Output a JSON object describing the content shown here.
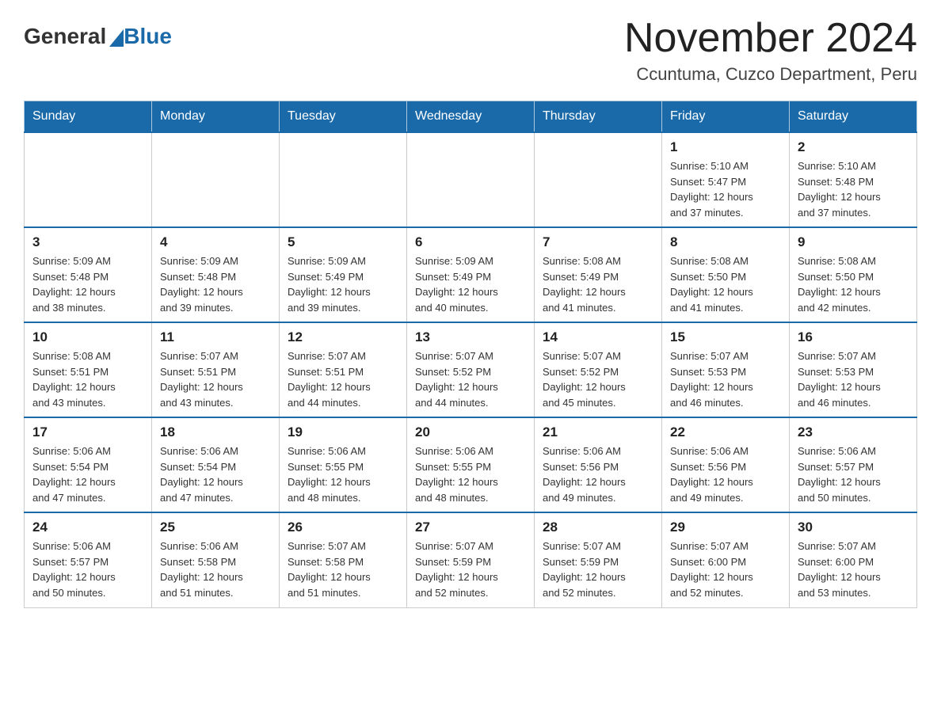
{
  "header": {
    "logo_general": "General",
    "logo_blue": "Blue",
    "title": "November 2024",
    "subtitle": "Ccuntuma, Cuzco Department, Peru"
  },
  "days_of_week": [
    "Sunday",
    "Monday",
    "Tuesday",
    "Wednesday",
    "Thursday",
    "Friday",
    "Saturday"
  ],
  "weeks": [
    {
      "days": [
        {
          "number": "",
          "info": ""
        },
        {
          "number": "",
          "info": ""
        },
        {
          "number": "",
          "info": ""
        },
        {
          "number": "",
          "info": ""
        },
        {
          "number": "",
          "info": ""
        },
        {
          "number": "1",
          "info": "Sunrise: 5:10 AM\nSunset: 5:47 PM\nDaylight: 12 hours\nand 37 minutes."
        },
        {
          "number": "2",
          "info": "Sunrise: 5:10 AM\nSunset: 5:48 PM\nDaylight: 12 hours\nand 37 minutes."
        }
      ]
    },
    {
      "days": [
        {
          "number": "3",
          "info": "Sunrise: 5:09 AM\nSunset: 5:48 PM\nDaylight: 12 hours\nand 38 minutes."
        },
        {
          "number": "4",
          "info": "Sunrise: 5:09 AM\nSunset: 5:48 PM\nDaylight: 12 hours\nand 39 minutes."
        },
        {
          "number": "5",
          "info": "Sunrise: 5:09 AM\nSunset: 5:49 PM\nDaylight: 12 hours\nand 39 minutes."
        },
        {
          "number": "6",
          "info": "Sunrise: 5:09 AM\nSunset: 5:49 PM\nDaylight: 12 hours\nand 40 minutes."
        },
        {
          "number": "7",
          "info": "Sunrise: 5:08 AM\nSunset: 5:49 PM\nDaylight: 12 hours\nand 41 minutes."
        },
        {
          "number": "8",
          "info": "Sunrise: 5:08 AM\nSunset: 5:50 PM\nDaylight: 12 hours\nand 41 minutes."
        },
        {
          "number": "9",
          "info": "Sunrise: 5:08 AM\nSunset: 5:50 PM\nDaylight: 12 hours\nand 42 minutes."
        }
      ]
    },
    {
      "days": [
        {
          "number": "10",
          "info": "Sunrise: 5:08 AM\nSunset: 5:51 PM\nDaylight: 12 hours\nand 43 minutes."
        },
        {
          "number": "11",
          "info": "Sunrise: 5:07 AM\nSunset: 5:51 PM\nDaylight: 12 hours\nand 43 minutes."
        },
        {
          "number": "12",
          "info": "Sunrise: 5:07 AM\nSunset: 5:51 PM\nDaylight: 12 hours\nand 44 minutes."
        },
        {
          "number": "13",
          "info": "Sunrise: 5:07 AM\nSunset: 5:52 PM\nDaylight: 12 hours\nand 44 minutes."
        },
        {
          "number": "14",
          "info": "Sunrise: 5:07 AM\nSunset: 5:52 PM\nDaylight: 12 hours\nand 45 minutes."
        },
        {
          "number": "15",
          "info": "Sunrise: 5:07 AM\nSunset: 5:53 PM\nDaylight: 12 hours\nand 46 minutes."
        },
        {
          "number": "16",
          "info": "Sunrise: 5:07 AM\nSunset: 5:53 PM\nDaylight: 12 hours\nand 46 minutes."
        }
      ]
    },
    {
      "days": [
        {
          "number": "17",
          "info": "Sunrise: 5:06 AM\nSunset: 5:54 PM\nDaylight: 12 hours\nand 47 minutes."
        },
        {
          "number": "18",
          "info": "Sunrise: 5:06 AM\nSunset: 5:54 PM\nDaylight: 12 hours\nand 47 minutes."
        },
        {
          "number": "19",
          "info": "Sunrise: 5:06 AM\nSunset: 5:55 PM\nDaylight: 12 hours\nand 48 minutes."
        },
        {
          "number": "20",
          "info": "Sunrise: 5:06 AM\nSunset: 5:55 PM\nDaylight: 12 hours\nand 48 minutes."
        },
        {
          "number": "21",
          "info": "Sunrise: 5:06 AM\nSunset: 5:56 PM\nDaylight: 12 hours\nand 49 minutes."
        },
        {
          "number": "22",
          "info": "Sunrise: 5:06 AM\nSunset: 5:56 PM\nDaylight: 12 hours\nand 49 minutes."
        },
        {
          "number": "23",
          "info": "Sunrise: 5:06 AM\nSunset: 5:57 PM\nDaylight: 12 hours\nand 50 minutes."
        }
      ]
    },
    {
      "days": [
        {
          "number": "24",
          "info": "Sunrise: 5:06 AM\nSunset: 5:57 PM\nDaylight: 12 hours\nand 50 minutes."
        },
        {
          "number": "25",
          "info": "Sunrise: 5:06 AM\nSunset: 5:58 PM\nDaylight: 12 hours\nand 51 minutes."
        },
        {
          "number": "26",
          "info": "Sunrise: 5:07 AM\nSunset: 5:58 PM\nDaylight: 12 hours\nand 51 minutes."
        },
        {
          "number": "27",
          "info": "Sunrise: 5:07 AM\nSunset: 5:59 PM\nDaylight: 12 hours\nand 52 minutes."
        },
        {
          "number": "28",
          "info": "Sunrise: 5:07 AM\nSunset: 5:59 PM\nDaylight: 12 hours\nand 52 minutes."
        },
        {
          "number": "29",
          "info": "Sunrise: 5:07 AM\nSunset: 6:00 PM\nDaylight: 12 hours\nand 52 minutes."
        },
        {
          "number": "30",
          "info": "Sunrise: 5:07 AM\nSunset: 6:00 PM\nDaylight: 12 hours\nand 53 minutes."
        }
      ]
    }
  ]
}
